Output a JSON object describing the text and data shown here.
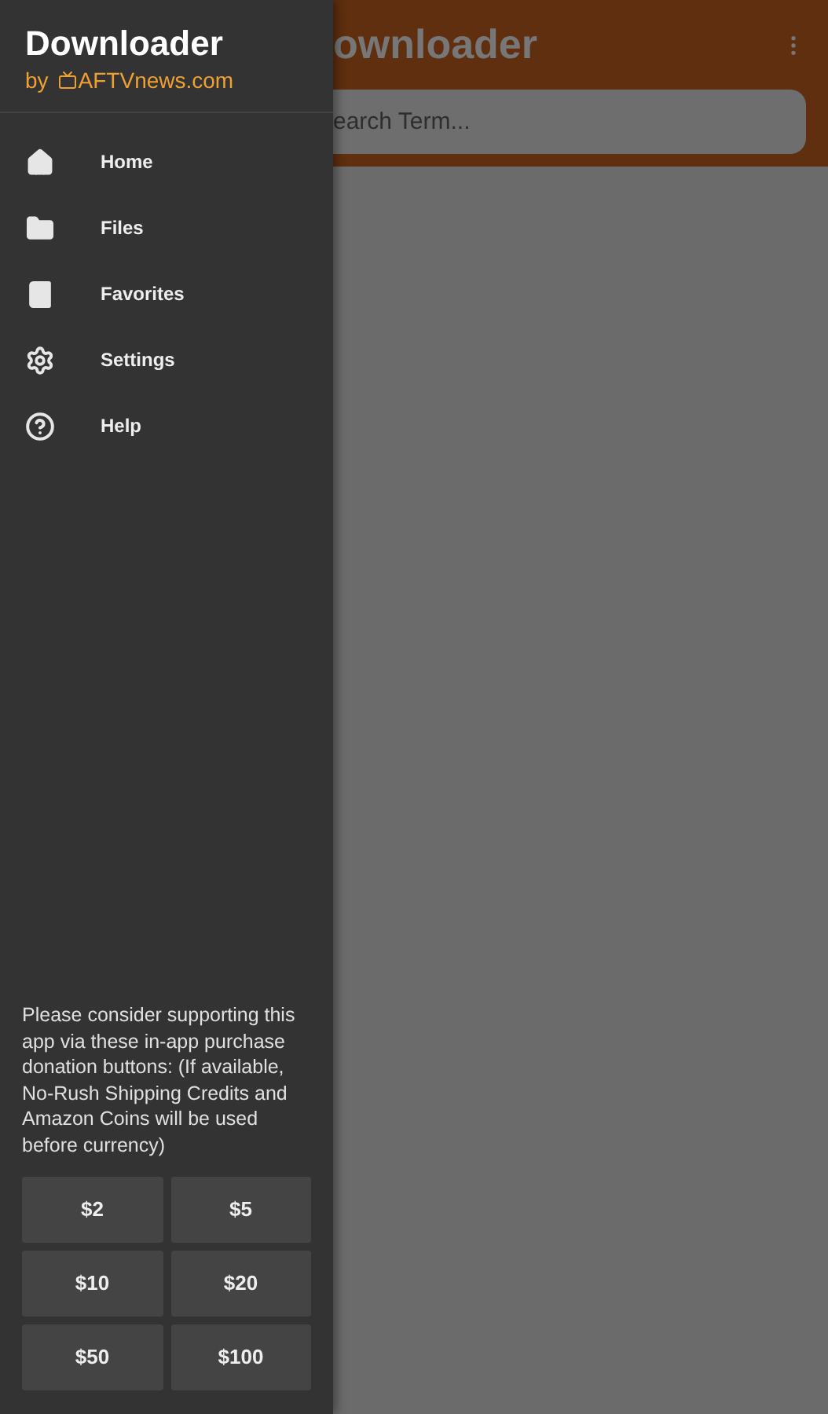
{
  "drawer": {
    "logo": {
      "name": "Downloader",
      "by": "by",
      "brand": "AFTVnews.com"
    },
    "items": [
      {
        "label": "Home",
        "kind": "home"
      },
      {
        "label": "Files",
        "kind": "files"
      },
      {
        "label": "Favorites",
        "kind": "favorites"
      },
      {
        "label": "Settings",
        "kind": "settings"
      },
      {
        "label": "Help",
        "kind": "help"
      }
    ],
    "donation_note": "Please consider supporting this app via these in-app purchase donation buttons: (If available, No-Rush Shipping Credits and Amazon Coins will be used before currency)",
    "donation_buttons": [
      "$2",
      "$5",
      "$10",
      "$20",
      "$50",
      "$100"
    ]
  },
  "app_bar": {
    "title": "ownloader",
    "search": {
      "placeholder": "earch Term..."
    }
  }
}
